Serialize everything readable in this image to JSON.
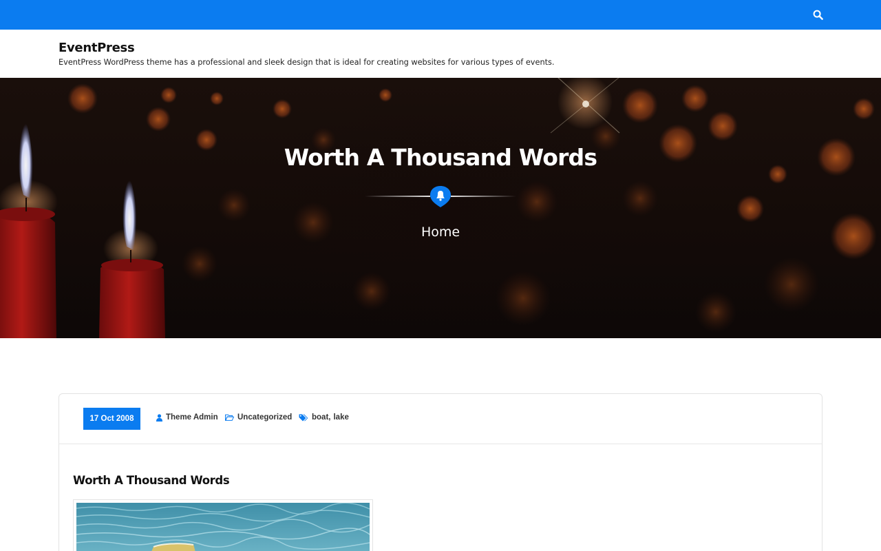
{
  "topbar": {
    "search_icon": "search-icon",
    "accent": "#0b7cf0"
  },
  "header": {
    "site_title": "EventPress",
    "site_description": "EventPress WordPress theme has a professional and sleek design that is ideal for creating websites for various types of events."
  },
  "hero": {
    "title": "Worth A Thousand Words",
    "divider_icon": "bell-icon",
    "breadcrumb": "Home"
  },
  "post": {
    "date": "17 Oct 2008",
    "author": "Theme Admin",
    "category": "Uncategorized",
    "tags": [
      "boat",
      "lake"
    ],
    "tag_separator": ",",
    "title": "Worth A Thousand Words"
  }
}
